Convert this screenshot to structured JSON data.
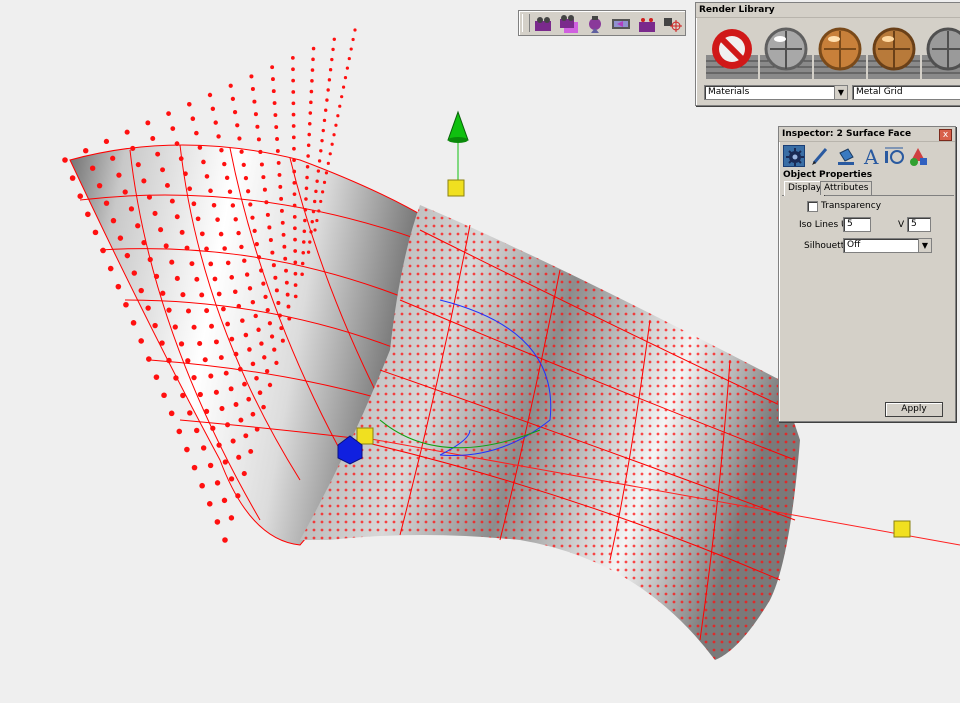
{
  "camera_toolbar": {
    "buttons": [
      {
        "name": "camera-icon",
        "color": "#7a2a8c"
      },
      {
        "name": "camera-select-icon",
        "color": "#b040c0"
      },
      {
        "name": "camera-target-icon",
        "color": "#8a3a9a"
      },
      {
        "name": "camera-film-icon",
        "color": "#555555"
      },
      {
        "name": "camera-pair-icon",
        "color": "#7a2a8c"
      },
      {
        "name": "camera-crosshair-icon",
        "color": "#d02020"
      }
    ]
  },
  "render_library": {
    "title": "Render Library",
    "materials": [
      {
        "name": "no-material-icon",
        "color": "#d01818"
      },
      {
        "name": "silver-material-icon",
        "color": "#a8a8a8"
      },
      {
        "name": "copper-material-icon",
        "color": "#c8803a"
      },
      {
        "name": "bronze-material-icon",
        "color": "#b87a3a"
      },
      {
        "name": "chrome-material-icon",
        "color": "#9a9a9a"
      }
    ],
    "category_select": "Materials",
    "library_select": "Metal Grid"
  },
  "inspector": {
    "title": "Inspector:  2 Surface Face",
    "close": "x",
    "section": "Object Properties",
    "tabs": [
      {
        "label": "Display",
        "active": true
      },
      {
        "label": "Attributes",
        "active": false
      }
    ],
    "transparency_label": "Transparency",
    "transparency_checked": false,
    "iso_u_label": "Iso Lines U",
    "iso_u_value": "5",
    "iso_v_label": "V",
    "iso_v_value": "5",
    "silhouette_label": "Silhouette",
    "silhouette_value": "Off",
    "apply_label": "Apply",
    "icons": [
      {
        "name": "object-properties-icon",
        "active": true
      },
      {
        "name": "pen-icon",
        "active": false
      },
      {
        "name": "paint-bucket-icon",
        "active": false
      },
      {
        "name": "text-icon",
        "active": false
      },
      {
        "name": "dimension-icon",
        "active": false
      },
      {
        "name": "render-shapes-icon",
        "active": false
      }
    ]
  },
  "viewport": {
    "surface_color": "#ff0000",
    "gizmo_colors": {
      "y_axis": "#10c010",
      "x_axis": "#ff2020",
      "z_axis": "#1020e0",
      "handle": "#f0e020"
    }
  }
}
